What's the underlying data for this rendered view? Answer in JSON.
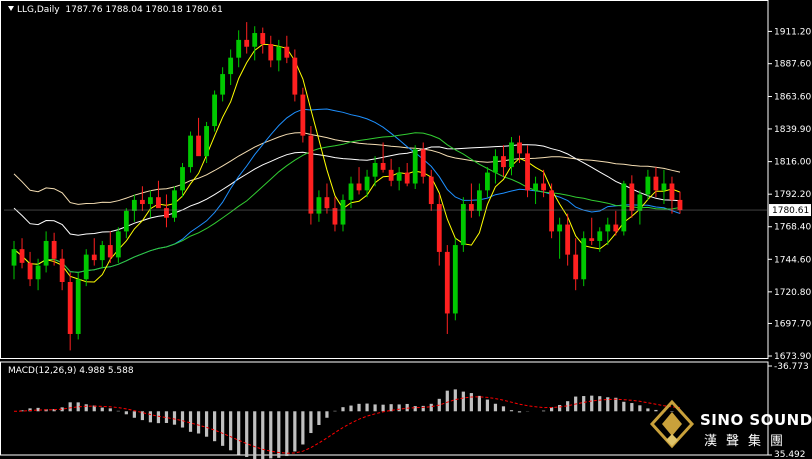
{
  "header": {
    "symbol_line": "LLG,Daily",
    "ohlc": "1787.76 1788.04 1780.18 1780.61"
  },
  "macd": {
    "label": "MACD(12,26,9) 4.988 5.588"
  },
  "price_axis": {
    "current_price": "1780.61"
  },
  "logo": {
    "text_en": "SINO SOUND",
    "text_zh": "漢聲集團"
  },
  "colors": {
    "background": "#000000",
    "bull_candle": "#00c800",
    "bear_candle": "#ff2020",
    "ma_yellow": "#ffff00",
    "ma_blue": "#1e90ff",
    "ma_green": "#32cd32",
    "ma_white": "#ffffff",
    "ma_wheat": "#f5deb3",
    "macd_hist": "#c0c0c0",
    "macd_signal": "#ff0000"
  },
  "chart_data": [
    {
      "type": "candlestick",
      "title": "LLG,Daily",
      "ylim": [
        1673.9,
        1921.0
      ],
      "yticks": [
        1911.2,
        1887.6,
        1863.6,
        1839.9,
        1816.0,
        1792.2,
        1768.4,
        1744.6,
        1720.8,
        1697.7,
        1673.9
      ],
      "last_close": 1780.61,
      "overlays": [
        "ma_yellow",
        "ma_blue",
        "ma_green",
        "ma_white",
        "ma_wheat"
      ],
      "ohlc": [
        [
          1740,
          1758,
          1730,
          1752
        ],
        [
          1752,
          1760,
          1738,
          1742
        ],
        [
          1742,
          1750,
          1725,
          1730
        ],
        [
          1730,
          1745,
          1722,
          1740
        ],
        [
          1740,
          1765,
          1735,
          1758
        ],
        [
          1758,
          1764,
          1740,
          1745
        ],
        [
          1745,
          1752,
          1722,
          1728
        ],
        [
          1728,
          1735,
          1678,
          1690
        ],
        [
          1690,
          1735,
          1686,
          1730
        ],
        [
          1730,
          1752,
          1725,
          1748
        ],
        [
          1748,
          1760,
          1740,
          1744
        ],
        [
          1744,
          1758,
          1738,
          1755
        ],
        [
          1755,
          1765,
          1742,
          1746
        ],
        [
          1746,
          1768,
          1742,
          1765
        ],
        [
          1765,
          1782,
          1760,
          1780
        ],
        [
          1780,
          1792,
          1772,
          1788
        ],
        [
          1788,
          1798,
          1780,
          1785
        ],
        [
          1785,
          1795,
          1775,
          1790
        ],
        [
          1790,
          1802,
          1785,
          1782
        ],
        [
          1782,
          1792,
          1768,
          1775
        ],
        [
          1775,
          1798,
          1772,
          1795
        ],
        [
          1795,
          1815,
          1790,
          1812
        ],
        [
          1812,
          1838,
          1808,
          1835
        ],
        [
          1835,
          1848,
          1828,
          1820
        ],
        [
          1820,
          1845,
          1815,
          1842
        ],
        [
          1842,
          1868,
          1838,
          1865
        ],
        [
          1865,
          1885,
          1860,
          1880
        ],
        [
          1880,
          1898,
          1872,
          1892
        ],
        [
          1892,
          1912,
          1885,
          1905
        ],
        [
          1905,
          1918,
          1895,
          1900
        ],
        [
          1900,
          1915,
          1890,
          1910
        ],
        [
          1910,
          1914,
          1895,
          1902
        ],
        [
          1902,
          1908,
          1885,
          1890
        ],
        [
          1890,
          1905,
          1882,
          1900
        ],
        [
          1900,
          1908,
          1888,
          1892
        ],
        [
          1892,
          1898,
          1860,
          1865
        ],
        [
          1865,
          1870,
          1830,
          1835
        ],
        [
          1835,
          1842,
          1770,
          1778
        ],
        [
          1778,
          1795,
          1772,
          1790
        ],
        [
          1790,
          1800,
          1778,
          1782
        ],
        [
          1782,
          1790,
          1765,
          1770
        ],
        [
          1770,
          1792,
          1765,
          1788
        ],
        [
          1788,
          1805,
          1782,
          1800
        ],
        [
          1800,
          1812,
          1792,
          1795
        ],
        [
          1795,
          1810,
          1790,
          1805
        ],
        [
          1805,
          1820,
          1798,
          1815
        ],
        [
          1815,
          1830,
          1808,
          1810
        ],
        [
          1810,
          1818,
          1798,
          1802
        ],
        [
          1802,
          1812,
          1795,
          1808
        ],
        [
          1808,
          1815,
          1798,
          1800
        ],
        [
          1800,
          1828,
          1796,
          1825
        ],
        [
          1825,
          1830,
          1800,
          1805
        ],
        [
          1805,
          1810,
          1780,
          1785
        ],
        [
          1785,
          1792,
          1740,
          1750
        ],
        [
          1750,
          1755,
          1690,
          1705
        ],
        [
          1705,
          1760,
          1700,
          1755
        ],
        [
          1755,
          1790,
          1750,
          1785
        ],
        [
          1785,
          1800,
          1775,
          1780
        ],
        [
          1780,
          1800,
          1776,
          1795
        ],
        [
          1795,
          1812,
          1790,
          1808
        ],
        [
          1808,
          1825,
          1800,
          1820
        ],
        [
          1820,
          1828,
          1805,
          1812
        ],
        [
          1812,
          1834,
          1806,
          1830
        ],
        [
          1830,
          1835,
          1815,
          1822
        ],
        [
          1822,
          1828,
          1790,
          1795
        ],
        [
          1795,
          1805,
          1785,
          1800
        ],
        [
          1800,
          1810,
          1790,
          1795
        ],
        [
          1795,
          1800,
          1760,
          1765
        ],
        [
          1765,
          1775,
          1745,
          1770
        ],
        [
          1770,
          1778,
          1740,
          1748
        ],
        [
          1748,
          1760,
          1722,
          1730
        ],
        [
          1730,
          1765,
          1725,
          1760
        ],
        [
          1760,
          1775,
          1755,
          1758
        ],
        [
          1758,
          1768,
          1750,
          1765
        ],
        [
          1765,
          1775,
          1755,
          1770
        ],
        [
          1770,
          1780,
          1762,
          1765
        ],
        [
          1765,
          1802,
          1762,
          1800
        ],
        [
          1800,
          1806,
          1775,
          1780
        ],
        [
          1780,
          1795,
          1770,
          1792
        ],
        [
          1792,
          1810,
          1788,
          1805
        ],
        [
          1805,
          1812,
          1790,
          1795
        ],
        [
          1795,
          1810,
          1785,
          1800
        ],
        [
          1800,
          1805,
          1778,
          1788
        ],
        [
          1788,
          1794,
          1778,
          1780.61
        ]
      ]
    },
    {
      "type": "macd",
      "title": "MACD(12,26,9) 4.988 5.588",
      "params": [
        12,
        26,
        9
      ],
      "macd_value": 4.988,
      "signal_value": 5.588,
      "ylim": [
        -36.773,
        35.492
      ],
      "yticks": [
        35.492,
        -36.773
      ]
    }
  ]
}
